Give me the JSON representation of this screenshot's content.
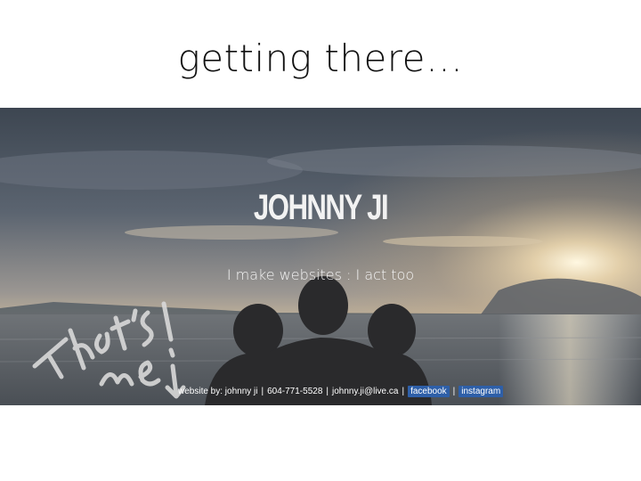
{
  "slide": {
    "title": "getting there…"
  },
  "site": {
    "name": "JOHNNY JI",
    "tagline": "I make websites  :  I act too",
    "handwriting": "That's me!",
    "footer": {
      "credit": "website by: johnny ji",
      "phone": "604-771-5528",
      "email": "johnny.ji@live.ca",
      "links": [
        "facebook",
        "instagram"
      ],
      "separator": "|"
    }
  },
  "colors": {
    "sky_top": "#4a5562",
    "sky_horizon": "#c9b79a",
    "sun": "#fff6de",
    "link_bg": "#2e5fa8"
  }
}
